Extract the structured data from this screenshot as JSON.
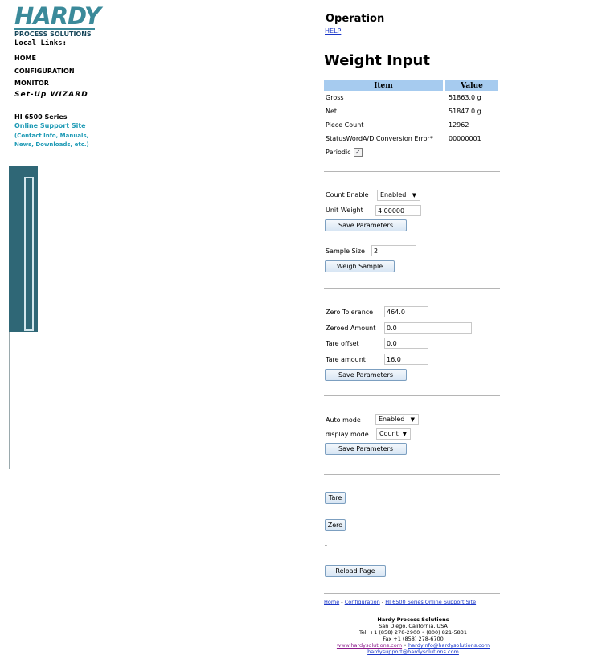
{
  "sidebar": {
    "logo_word": "HARDY",
    "logo_sub": "PROCESS SOLUTIONS",
    "local_links_heading": "Local Links:",
    "links": [
      "HOME",
      "CONFIGURATION",
      "MONITOR"
    ],
    "wizard": "Set-Up WIZARD",
    "series_title": "HI 6500 Series",
    "series_link": "Online Support Site",
    "series_sub_1": "(Contact Info, Manuals,",
    "series_sub_2": "News, Downloads, etc.)"
  },
  "header": {
    "operation": "Operation",
    "help": "HELP",
    "page_title": "Weight Input"
  },
  "table": {
    "headers": [
      "Item",
      "Value"
    ],
    "rows": [
      {
        "item": "Gross",
        "value": "51863.0 g"
      },
      {
        "item": "Net",
        "value": "51847.0 g"
      },
      {
        "item": "Piece Count",
        "value": "12962"
      },
      {
        "item": "StatusWordA/D Conversion Error*",
        "value": "00000001"
      }
    ]
  },
  "periodic": {
    "label": "Periodic",
    "checked": true,
    "mark": "✓"
  },
  "count_section": {
    "count_enable_label": "Count Enable",
    "count_enable_value": "Enabled",
    "unit_weight_label": "Unit Weight",
    "unit_weight_value": "4.00000",
    "save_label": "Save Parameters",
    "sample_size_label": "Sample Size",
    "sample_size_value": "2",
    "weigh_sample_label": "Weigh Sample"
  },
  "zero_section": {
    "zero_tolerance_label": "Zero Tolerance",
    "zero_tolerance_value": "464.0",
    "zeroed_amount_label": "Zeroed Amount",
    "zeroed_amount_value": "0.0",
    "tare_offset_label": "Tare offset",
    "tare_offset_value": "0.0",
    "tare_amount_label": "Tare amount",
    "tare_amount_value": "16.0",
    "save_label": "Save Parameters"
  },
  "mode_section": {
    "auto_mode_label": "Auto mode",
    "auto_mode_value": "Enabled",
    "display_mode_label": "display mode",
    "display_mode_value": "Count",
    "save_label": "Save Parameters"
  },
  "actions": {
    "tare": "Tare",
    "zero": "Zero",
    "dash": "-",
    "reload": "Reload Page"
  },
  "footer": {
    "home": "Home",
    "configuration": "Configuration",
    "support": "HI 6500 Series Online Support Site",
    "sep": " - ",
    "company": "Hardy Process Solutions",
    "city": "San Diego, California, USA",
    "tel": "Tel. +1 (858) 278-2900 • (800) 821-5831",
    "fax": "Fax +1 (858) 278-6700",
    "web": "www.hardysolutions.com",
    "bullet": " • ",
    "info_email": "hardyinfo@hardysolutions.com",
    "support_email": "hardysupport@hardysolutions.com"
  }
}
